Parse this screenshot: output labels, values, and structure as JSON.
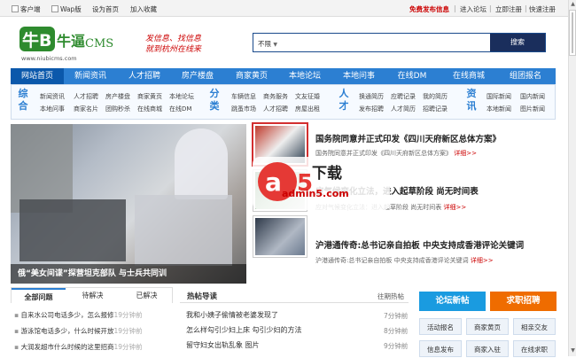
{
  "topbar": {
    "client": "客户端",
    "wap": "Wap版",
    "homepage": "设为首页",
    "favorite": "加入收藏",
    "free_post": "免费发布信息",
    "enter_forum": "进入论坛",
    "register": "立即注册",
    "quick_register": "快速注册",
    "sep": "|"
  },
  "logo": {
    "url": "www.niubicms.com"
  },
  "slogan": [
    "发信息、找信息",
    "就到杭州在线来"
  ],
  "search": {
    "select_value": "不限",
    "button": "搜索"
  },
  "nav": [
    "网站首页",
    "新闻资讯",
    "人才招聘",
    "房产楼盘",
    "商家黄页",
    "本地论坛",
    "本地问事",
    "在线DM",
    "在线商城",
    "组团报名"
  ],
  "subnav": {
    "groups": [
      {
        "label": [
          "综",
          "合"
        ],
        "rows": [
          [
            "新闻资讯",
            "人才招聘",
            "房产楼盘",
            "商家黄页",
            "本地论坛"
          ],
          [
            "本地问事",
            "商家名片",
            "团购秒杀",
            "在线商城",
            "在线DM"
          ]
        ]
      },
      {
        "label": [
          "分",
          "类"
        ],
        "rows": [
          [
            "车辆信息",
            "商务服务",
            "文友征婚"
          ],
          [
            "跳蚤市场",
            "人才招聘",
            "房屋出租"
          ]
        ]
      },
      {
        "label": [
          "人",
          "才"
        ],
        "rows": [
          [
            "换通简历",
            "应聘记录",
            "我的简历"
          ],
          [
            "发布招聘",
            "人才简历",
            "招聘记录"
          ]
        ]
      },
      {
        "label": [
          "资",
          "讯"
        ],
        "rows": [
          [
            "国际新闻",
            "国内新闻"
          ],
          [
            "本地新闻",
            "图片新闻"
          ]
        ]
      }
    ]
  },
  "hero": {
    "caption": "俄“美女间谍”探营坦克部队 与士兵共同训"
  },
  "news": [
    {
      "headline": "国务院同意并正式印发《四川天府新区总体方案》",
      "desc": "国务院同意并正式印发《四川天府新区总体方案》",
      "more": "详细>>"
    },
    {
      "headline": "应气候变化立法，进入起草阶段 尚无时间表",
      "desc": "应对气候变化立法：进入起草阶段 尚无时间表",
      "more": "详细>>"
    },
    {
      "headline": "沪港通传奇:总书记亲自拍板 中央支持成香港评论关键词",
      "desc": "沪港通传奇:总书记亲自拍板 中央支持成香港评论关键词",
      "more": "详细>>"
    }
  ],
  "watermark": {
    "brand": "下载",
    "site": "admin5.com"
  },
  "qa": {
    "tabs": [
      "全部问题",
      "待解决",
      "已解决"
    ],
    "items": [
      {
        "text": "自来水公司电话多少，怎么报修",
        "time": "19分钟前"
      },
      {
        "text": "游泳馆电话多少，什么时候开放",
        "time": "19分钟前"
      },
      {
        "text": "大润发超市什么时候的这里招商",
        "time": "19分钟前"
      }
    ]
  },
  "hot": {
    "title": "热帖导读",
    "tag": "往期热帖",
    "items": [
      {
        "text": "我和小姨子偷情被老婆发现了",
        "time": "7分钟前"
      },
      {
        "text": "怎么样勾引少妇上床 勾引少妇的方法",
        "time": "8分钟前"
      },
      {
        "text": "留守妇女出轨乱象 图片",
        "time": "9分钟前"
      }
    ]
  },
  "right": {
    "forum_post": "论坛新帖",
    "job_post": "求职招聘",
    "colors": {
      "forum": "#1a9be0",
      "job": "#ef6c00"
    },
    "buttons": [
      [
        "活动报名",
        "商家黄页",
        "相亲交友"
      ],
      [
        "信息发布",
        "商家入驻",
        "在线求职"
      ]
    ]
  },
  "colors": {
    "nav": "#2c7fd2",
    "nav_active": "#0b58ab",
    "accent_red": "#c00"
  }
}
